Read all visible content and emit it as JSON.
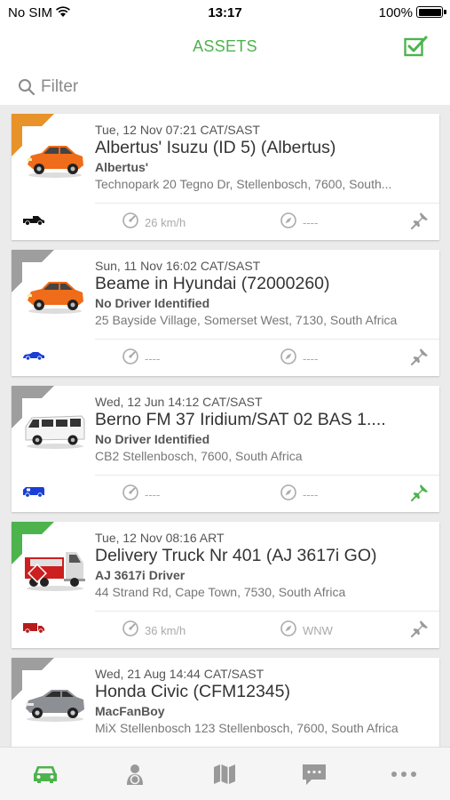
{
  "status_bar": {
    "carrier": "No SIM",
    "time": "13:17",
    "battery": "100%"
  },
  "nav": {
    "title": "ASSETS"
  },
  "filter": {
    "placeholder": "Filter"
  },
  "colors": {
    "accent": "#4db34d",
    "orange": "#e8922a",
    "gray": "#9e9e9e",
    "blue": "#1a3fd6",
    "red": "#b71c1c"
  },
  "assets": [
    {
      "timestamp": "Tue, 12 Nov 07:21 CAT/SAST",
      "name": "Albertus' Isuzu (ID 5) (Albertus)",
      "driver": "Albertus'",
      "address": "Technopark 20 Tegno Dr, Stellenbosch, 7600, South...",
      "speed": "26 km/h",
      "heading": "----",
      "status_color": "orange",
      "image": "orange-car-icon",
      "type_icon": "pickup-truck-icon",
      "pin_active": false
    },
    {
      "timestamp": "Sun, 11 Nov 16:02 CAT/SAST",
      "name": "Beame in Hyundai (72000260)",
      "driver": "No Driver Identified",
      "address": "25 Bayside Village, Somerset West, 7130, South Africa",
      "speed": "----",
      "heading": "----",
      "status_color": "gray",
      "image": "orange-car-icon",
      "type_icon": "sedan-icon",
      "pin_active": false
    },
    {
      "timestamp": "Wed, 12 Jun 14:12 CAT/SAST",
      "name": "Berno FM 37 Iridium/SAT 02 BAS 1....",
      "driver": "No Driver Identified",
      "address": "CB2 Stellenbosch, 7600, South Africa",
      "speed": "----",
      "heading": "----",
      "status_color": "gray",
      "image": "white-van-icon",
      "type_icon": "van-icon",
      "pin_active": true
    },
    {
      "timestamp": "Tue, 12 Nov 08:16 ART",
      "name": "Delivery Truck Nr 401 (AJ 3617i GO)",
      "driver": "AJ 3617i Driver",
      "address": "44 Strand Rd, Cape Town, 7530, South Africa",
      "speed": "36 km/h",
      "heading": "WNW",
      "status_color": "green",
      "image": "red-tanker-truck-icon",
      "type_icon": "delivery-truck-icon",
      "pin_active": false
    },
    {
      "timestamp": "Wed, 21 Aug 14:44 CAT/SAST",
      "name": "Honda Civic (CFM12345)",
      "driver": "MacFanBoy",
      "address": "MiX Stellenbosch 123 Stellenbosch, 7600, South Africa",
      "speed": "----",
      "heading": "----",
      "status_color": "gray",
      "image": "gray-sedan-icon",
      "type_icon": "sedan-icon",
      "pin_active": false
    }
  ],
  "tabs": [
    {
      "icon": "car-icon",
      "active": true
    },
    {
      "icon": "driver-icon",
      "active": false
    },
    {
      "icon": "map-icon",
      "active": false
    },
    {
      "icon": "message-icon",
      "active": false
    },
    {
      "icon": "more-icon",
      "active": false
    }
  ]
}
